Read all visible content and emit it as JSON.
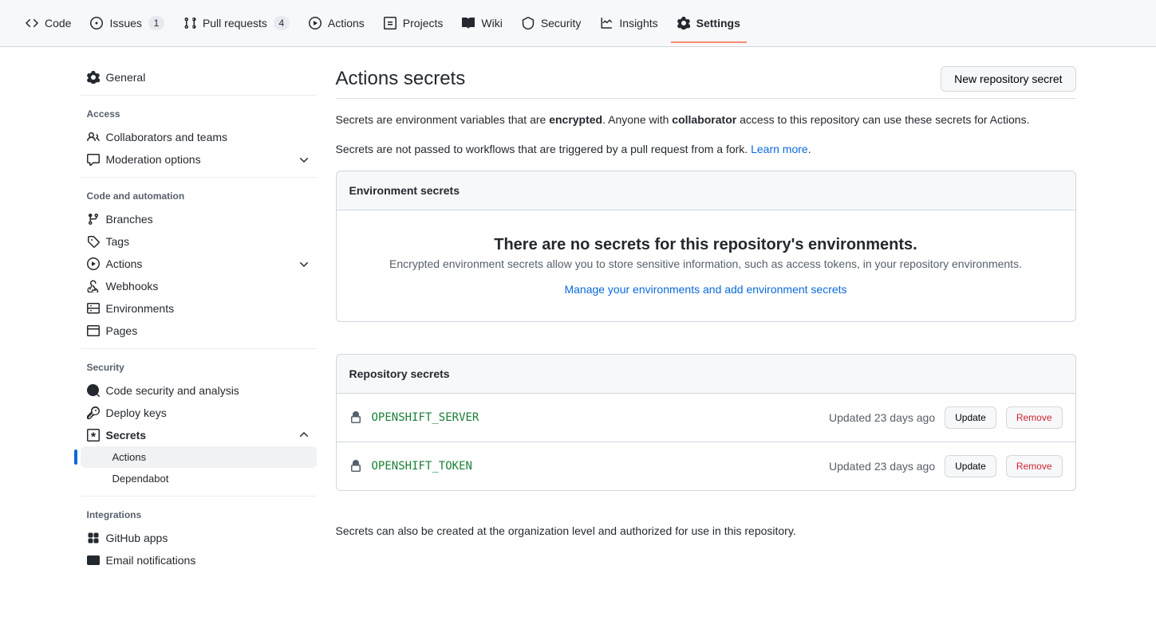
{
  "topnav": {
    "code": "Code",
    "issues": "Issues",
    "issues_count": "1",
    "pulls": "Pull requests",
    "pulls_count": "4",
    "actions": "Actions",
    "projects": "Projects",
    "wiki": "Wiki",
    "security": "Security",
    "insights": "Insights",
    "settings": "Settings"
  },
  "sidebar": {
    "general": "General",
    "access_title": "Access",
    "collaborators": "Collaborators and teams",
    "moderation": "Moderation options",
    "code_title": "Code and automation",
    "branches": "Branches",
    "tags": "Tags",
    "actions": "Actions",
    "webhooks": "Webhooks",
    "environments": "Environments",
    "pages": "Pages",
    "security_title": "Security",
    "code_security": "Code security and analysis",
    "deploy_keys": "Deploy keys",
    "secrets": "Secrets",
    "secrets_actions": "Actions",
    "secrets_dependabot": "Dependabot",
    "integrations_title": "Integrations",
    "github_apps": "GitHub apps",
    "email_notifications": "Email notifications"
  },
  "main": {
    "title": "Actions secrets",
    "new_secret_btn": "New repository secret",
    "desc1_a": "Secrets are environment variables that are ",
    "desc1_b": "encrypted",
    "desc1_c": ". Anyone with ",
    "desc1_d": "collaborator",
    "desc1_e": " access to this repository can use these secrets for Actions.",
    "desc2_a": "Secrets are not passed to workflows that are triggered by a pull request from a fork. ",
    "desc2_b": "Learn more",
    "desc2_c": ".",
    "env_header": "Environment secrets",
    "env_empty_title": "There are no secrets for this repository's environments.",
    "env_empty_desc": "Encrypted environment secrets allow you to store sensitive information, such as access tokens, in your repository environments.",
    "env_manage_link": "Manage your environments and add environment secrets",
    "repo_header": "Repository secrets",
    "update_btn": "Update",
    "remove_btn": "Remove",
    "secrets": [
      {
        "name": "OPENSHIFT_SERVER",
        "updated": "Updated 23 days ago"
      },
      {
        "name": "OPENSHIFT_TOKEN",
        "updated": "Updated 23 days ago"
      }
    ],
    "org_note": "Secrets can also be created at the organization level and authorized for use in this repository."
  }
}
